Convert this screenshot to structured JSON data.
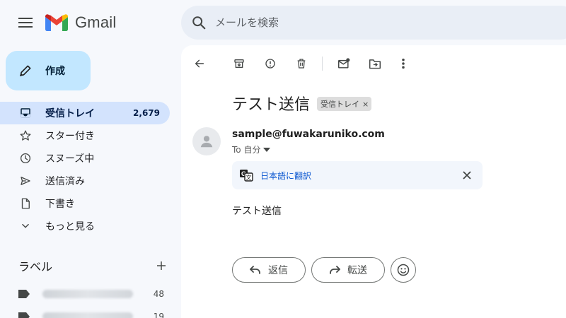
{
  "header": {
    "app_name": "Gmail",
    "search_placeholder": "メールを検索"
  },
  "sidebar": {
    "compose_label": "作成",
    "items": [
      {
        "label": "受信トレイ",
        "count": "2,679",
        "icon": "inbox-icon"
      },
      {
        "label": "スター付き",
        "count": "",
        "icon": "star-icon"
      },
      {
        "label": "スヌーズ中",
        "count": "",
        "icon": "clock-icon"
      },
      {
        "label": "送信済み",
        "count": "",
        "icon": "send-icon"
      },
      {
        "label": "下書き",
        "count": "",
        "icon": "draft-icon"
      },
      {
        "label": "もっと見る",
        "count": "",
        "icon": "chevron-down-icon"
      }
    ],
    "labels_title": "ラベル",
    "labels": [
      {
        "count": "48"
      },
      {
        "count": "19"
      }
    ]
  },
  "message": {
    "subject": "テスト送信",
    "chip_label": "受信トレイ",
    "chip_close": "×",
    "sender": "sample@fuwakaruniko.com",
    "to_line": "To 自分",
    "translate_label": "日本語に翻訳",
    "body": "テスト送信"
  },
  "actions": {
    "reply": "返信",
    "forward": "転送"
  },
  "colors": {
    "background": "#f6f8fc",
    "compose_bg": "#c2e7ff",
    "active_nav_bg": "#d3e3fd",
    "link_blue": "#0b57d0",
    "search_bg": "#e9eef6"
  }
}
